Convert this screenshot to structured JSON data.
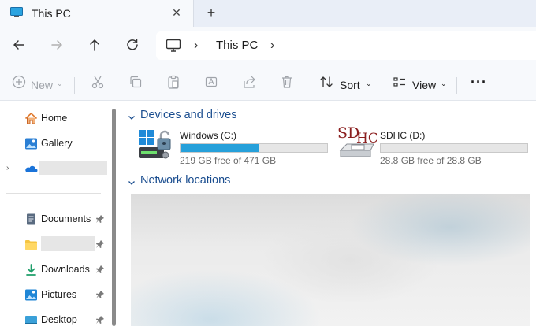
{
  "tab": {
    "title": "This PC",
    "close_glyph": "✕",
    "new_tab_glyph": "+"
  },
  "address": {
    "crumb": "This PC",
    "sep1": "›",
    "sep2": "›"
  },
  "toolbar": {
    "new_label": "New",
    "sort_label": "Sort",
    "view_label": "View",
    "more_glyph": "···",
    "chevron_glyph": "⌄"
  },
  "sidebar": {
    "items": [
      {
        "label": "Home",
        "icon": "home-icon"
      },
      {
        "label": "Gallery",
        "icon": "gallery-icon"
      },
      {
        "label": "",
        "icon": "onedrive-icon"
      },
      {
        "label": "Documents",
        "icon": "documents-icon"
      },
      {
        "label": "",
        "icon": "folder-icon"
      },
      {
        "label": "Downloads",
        "icon": "downloads-icon"
      },
      {
        "label": "Pictures",
        "icon": "pictures-icon"
      },
      {
        "label": "Desktop",
        "icon": "desktop-icon"
      }
    ],
    "expander_glyph": "›"
  },
  "groups": {
    "devices": "Devices and drives",
    "network": "Network locations"
  },
  "drives": [
    {
      "name": "Windows (C:)",
      "free": "219 GB free of 471 GB",
      "used_fraction": 0.535,
      "icon": "windows-drive-icon"
    },
    {
      "name": "SDHC (D:)",
      "free": "28.8 GB free of 28.8 GB",
      "used_fraction": 0.0,
      "icon": "sdhc-drive-icon"
    }
  ],
  "colors": {
    "accent": "#1a4d8f",
    "drive_fill": "#26a0da"
  }
}
